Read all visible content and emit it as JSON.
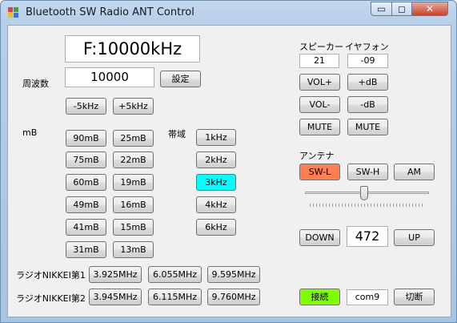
{
  "window": {
    "title": "Bluetooth SW Radio ANT Control",
    "min_glyph": "▭",
    "max_glyph": "◻",
    "close_glyph": "✕"
  },
  "display": {
    "freq_display": "F:10000kHz"
  },
  "frequency": {
    "label": "周波数",
    "value": "10000",
    "set_button": "設定"
  },
  "step": {
    "minus": "-5kHz",
    "plus": "+5kHz"
  },
  "meter_band": {
    "label": "mB",
    "bands": [
      "90mB",
      "25mB",
      "75mB",
      "22mB",
      "60mB",
      "19mB",
      "49mB",
      "16mB",
      "41mB",
      "15mB",
      "31mB",
      "13mB"
    ]
  },
  "bandwidth": {
    "label": "帯域",
    "options": [
      "1kHz",
      "2kHz",
      "3kHz",
      "4kHz",
      "6kHz"
    ],
    "selected": "3kHz",
    "selected_color": "#00ffff"
  },
  "presets": [
    {
      "label": "ラジオNIKKEI第1",
      "freqs": [
        "3.925MHz",
        "6.055MHz",
        "9.595MHz"
      ]
    },
    {
      "label": "ラジオNIKKEI第2",
      "freqs": [
        "3.945MHz",
        "6.115MHz",
        "9.760MHz"
      ]
    }
  ],
  "speaker": {
    "label": "スピーカー",
    "value": "21",
    "vol_up": "VOL+",
    "vol_down": "VOL-",
    "mute": "MUTE"
  },
  "earphone": {
    "label": "イヤフォン",
    "value": "-09",
    "up": "+dB",
    "down": "-dB",
    "mute": "MUTE"
  },
  "antenna": {
    "label": "アンテナ",
    "options": [
      "SW-L",
      "SW-H",
      "AM"
    ],
    "selected": "SW-L",
    "selected_color": "#ff7f50"
  },
  "tuner": {
    "down": "DOWN",
    "value": "472",
    "up": "UP"
  },
  "connection": {
    "connect": "接続",
    "connect_color": "#7fff00",
    "port": "com9",
    "disconnect": "切断"
  }
}
